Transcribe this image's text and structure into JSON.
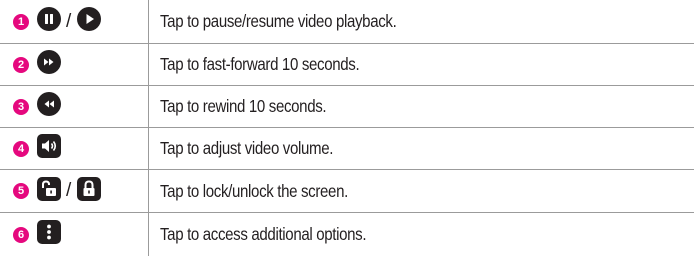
{
  "rows": [
    {
      "number": "1",
      "icons": [
        "pause-icon",
        "play-icon"
      ],
      "separator": "/",
      "description": "Tap to pause/resume video playback."
    },
    {
      "number": "2",
      "icons": [
        "fast-forward-icon"
      ],
      "description": "Tap to fast-forward 10 seconds."
    },
    {
      "number": "3",
      "icons": [
        "rewind-icon"
      ],
      "description": "Tap to rewind 10 seconds."
    },
    {
      "number": "4",
      "icons": [
        "volume-icon"
      ],
      "description": "Tap to adjust video volume."
    },
    {
      "number": "5",
      "icons": [
        "unlock-icon",
        "lock-icon"
      ],
      "separator": "/",
      "description": "Tap to lock/unlock the screen."
    },
    {
      "number": "6",
      "icons": [
        "more-options-icon"
      ],
      "description": "Tap to access additional options."
    }
  ],
  "colors": {
    "badge": "#e5087e",
    "icon": "#231f20",
    "border": "#9b9b9b"
  }
}
